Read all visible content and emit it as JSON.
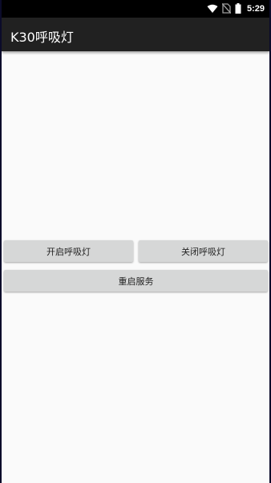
{
  "status_bar": {
    "time": "5:29",
    "icons": [
      "wifi-icon",
      "no-sim-icon",
      "battery-icon"
    ]
  },
  "app_bar": {
    "title": "K30呼吸灯"
  },
  "buttons": {
    "start_label": "开启呼吸灯",
    "stop_label": "关闭呼吸灯",
    "restart_label": "重启服务"
  },
  "colors": {
    "status_bar": "#000000",
    "app_bar": "#212121",
    "background": "#fafafa",
    "button": "#d6d7d7"
  }
}
